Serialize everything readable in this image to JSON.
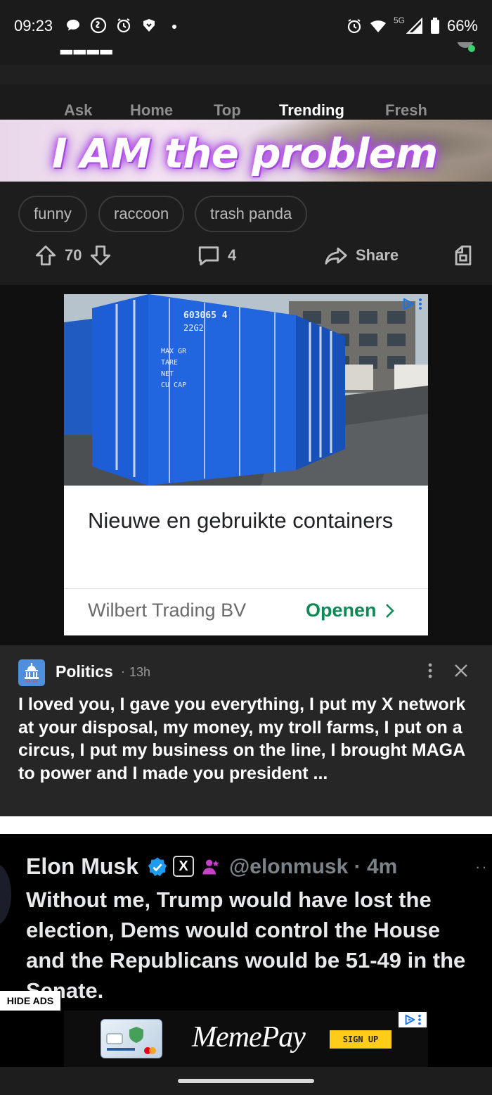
{
  "status_bar": {
    "time": "09:23",
    "left_icons": [
      "chat-bubble-icon",
      "shazam-icon",
      "alarm-icon",
      "app-icon",
      "dot-icon"
    ],
    "network": "5G",
    "battery": "66%"
  },
  "nav": {
    "tabs": [
      {
        "label": "Ask",
        "active": false
      },
      {
        "label": "Home",
        "active": false
      },
      {
        "label": "Top",
        "active": false
      },
      {
        "label": "Trending",
        "active": true
      },
      {
        "label": "Fresh",
        "active": false
      }
    ]
  },
  "meme": {
    "caption": "I AM the problem"
  },
  "post": {
    "tags": [
      "funny",
      "raccoon",
      "trash panda"
    ],
    "upvotes": "70",
    "comments": "4",
    "share_label": "Share"
  },
  "ad": {
    "title": "Nieuwe en gebruikte containers",
    "advertiser": "Wilbert Trading BV",
    "cta": "Openen",
    "container_code": "603065 4",
    "container_type": "22G2",
    "container_specs": [
      "MAX GR",
      "TARE",
      "NET",
      "CU CAP"
    ]
  },
  "politics_post": {
    "category": "Politics",
    "separator": "·",
    "time": "13h",
    "text": "I loved you, I gave you everything, I put my X network at your disposal, my money, my troll farms, I put on a circus, I put my business on the line, I brought MAGA to power and I made you president ..."
  },
  "tweet": {
    "name": "Elon Musk",
    "x_badge": "X",
    "handle_time": "@elonmusk · 4m",
    "more": "··",
    "text": "Without me, Trump would have lost the election, Dems would control the House and the Republicans would be 51-49 in the Senate."
  },
  "hide_ads_label": "HIDE ADS",
  "banner_ad": {
    "brand": "MemePay",
    "cta": "SIGN UP"
  },
  "colors": {
    "background": "#1d1d1d",
    "ad_cta_green": "#0b8a54",
    "politics_bg": "#262626",
    "signup_yellow": "#ffcc1a",
    "verified_blue": "#1d9bf0"
  }
}
